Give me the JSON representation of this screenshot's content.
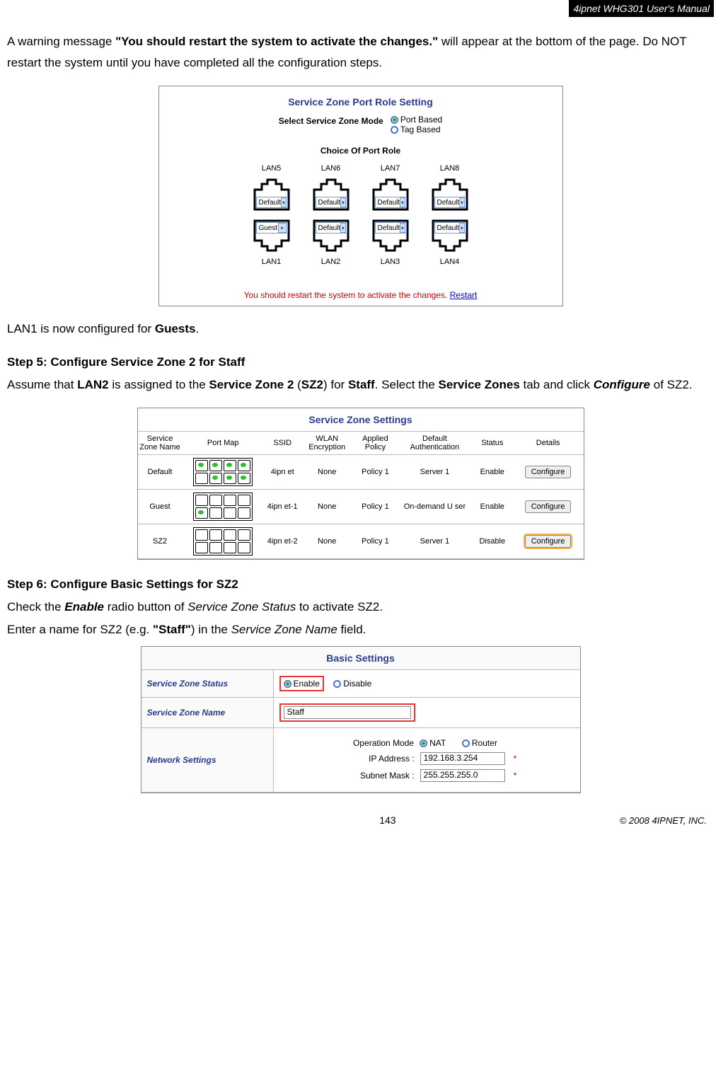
{
  "header": {
    "manual_title": "4ipnet WHG301 User's Manual"
  },
  "intro": {
    "prefix": "A warning message ",
    "bold_msg": "\"You should restart the system to activate the changes.\"",
    "suffix": " will appear at the bottom of the page. Do NOT restart the system until you have completed all the configuration steps."
  },
  "fig1": {
    "title": "Service Zone Port Role Setting",
    "mode_label": "Select Service Zone Mode",
    "mode_options": {
      "port": "Port Based",
      "tag": "Tag Based"
    },
    "choice_label": "Choice Of Port Role",
    "top_port_labels": [
      "LAN5",
      "LAN6",
      "LAN7",
      "LAN8"
    ],
    "top_port_values": [
      "Default",
      "Default",
      "Default",
      "Default"
    ],
    "bottom_port_values": [
      "Guest",
      "Default",
      "Default",
      "Default"
    ],
    "bottom_port_labels": [
      "LAN1",
      "LAN2",
      "LAN3",
      "LAN4"
    ],
    "restart_text": "You should restart the system to activate the changes. ",
    "restart_link": "Restart"
  },
  "after_fig1": {
    "prefix": "LAN1 is now configured for ",
    "bold": "Guests",
    "suffix": "."
  },
  "step5": {
    "heading": "Step 5: Configure Service Zone 2 for Staff",
    "p1a": "Assume that ",
    "p1b": "LAN2",
    "p1c": " is assigned to the ",
    "p1d": "Service Zone 2",
    "p1e": " (",
    "p1f": "SZ2",
    "p1g": ") for ",
    "p1h": "Staff",
    "p1i": ". Select the ",
    "p1j": "Service Zones",
    "p1k": " tab and click ",
    "p1l": "Configure",
    "p1m": " of SZ2."
  },
  "fig2": {
    "title": "Service Zone Settings",
    "headers": [
      "Service Zone Name",
      "Port Map",
      "SSID",
      "WLAN Encryption",
      "Applied Policy",
      "Default Authentication",
      "Status",
      "Details"
    ],
    "rows": [
      {
        "name": "Default",
        "ports_top": [
          1,
          1,
          1,
          1
        ],
        "ports_bot": [
          0,
          1,
          1,
          1
        ],
        "ssid": "4ipn et",
        "enc": "None",
        "pol": "Policy 1",
        "auth": "Server 1",
        "status": "Enable",
        "btn": "Configure",
        "hl": false
      },
      {
        "name": "Guest",
        "ports_top": [
          0,
          0,
          0,
          0
        ],
        "ports_bot": [
          1,
          0,
          0,
          0
        ],
        "ssid": "4ipn et-1",
        "enc": "None",
        "pol": "Policy 1",
        "auth": "On-demand U ser",
        "status": "Enable",
        "btn": "Configure",
        "hl": false
      },
      {
        "name": "SZ2",
        "ports_top": [
          0,
          0,
          0,
          0
        ],
        "ports_bot": [
          0,
          0,
          0,
          0
        ],
        "ssid": "4ipn et-2",
        "enc": "None",
        "pol": "Policy 1",
        "auth": "Server 1",
        "status": "Disable",
        "btn": "Configure",
        "hl": true
      }
    ]
  },
  "step6": {
    "heading": "Step 6: Configure Basic Settings for SZ2",
    "l1a": "Check the ",
    "l1b": "Enable",
    "l1c": " radio button of ",
    "l1d": "Service Zone Status",
    "l1e": " to activate SZ2.",
    "l2a": "Enter a name for SZ2 (e.g. ",
    "l2b": "\"Staff\"",
    "l2c": ") in the ",
    "l2d": "Service Zone Name",
    "l2e": " field."
  },
  "fig3": {
    "title": "Basic Settings",
    "row1_label": "Service Zone Status",
    "enable": "Enable",
    "disable": "Disable",
    "row2_label": "Service Zone Name",
    "zone_name_value": "Staff",
    "row3_label": "Network Settings",
    "op_mode_label": "Operation Mode",
    "nat": "NAT",
    "router": "Router",
    "ip_label": "IP Address :",
    "ip_value": "192.168.3.254",
    "mask_label": "Subnet Mask :",
    "mask_value": "255.255.255.0"
  },
  "footer": {
    "page": "143",
    "copyright": "© 2008 4IPNET, INC."
  }
}
